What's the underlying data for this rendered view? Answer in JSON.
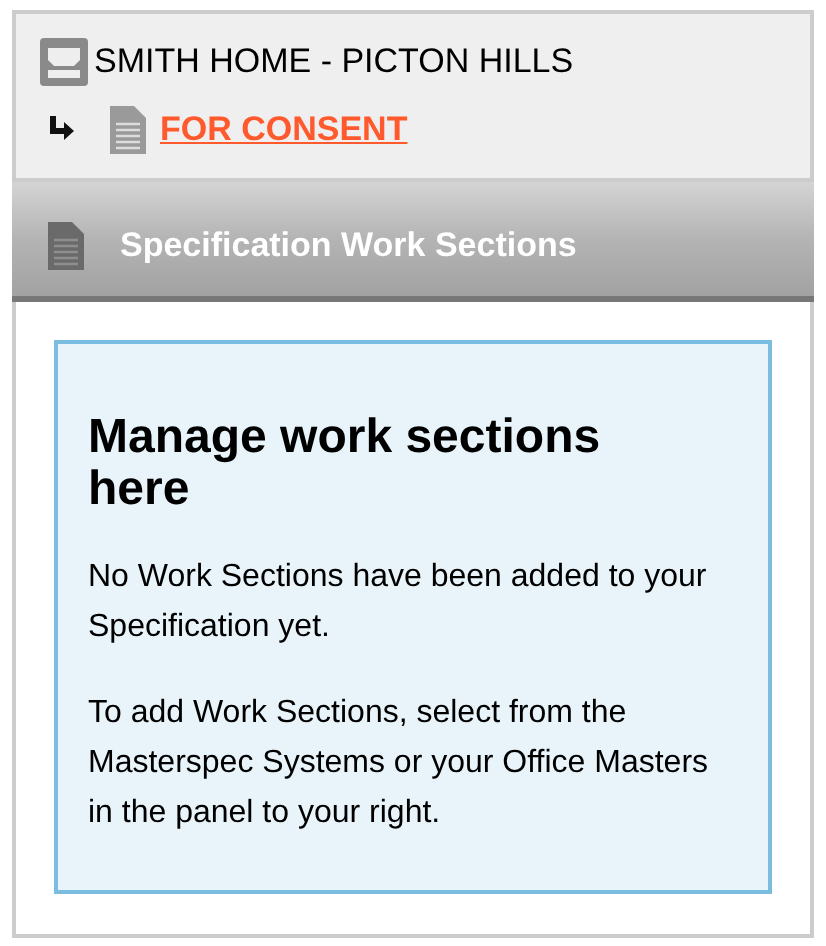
{
  "project": {
    "title": "SMITH HOME - PICTON HILLS"
  },
  "stage": {
    "link": "FOR CONSENT"
  },
  "section_bar": {
    "title": "Specification Work Sections"
  },
  "info_box": {
    "heading": "Manage work sections here",
    "paragraphs": [
      "No Work Sections have been added to your Specification yet.",
      "To add Work Sections, select from the Masterspec Systems or your Office Masters in the panel to your right."
    ]
  }
}
